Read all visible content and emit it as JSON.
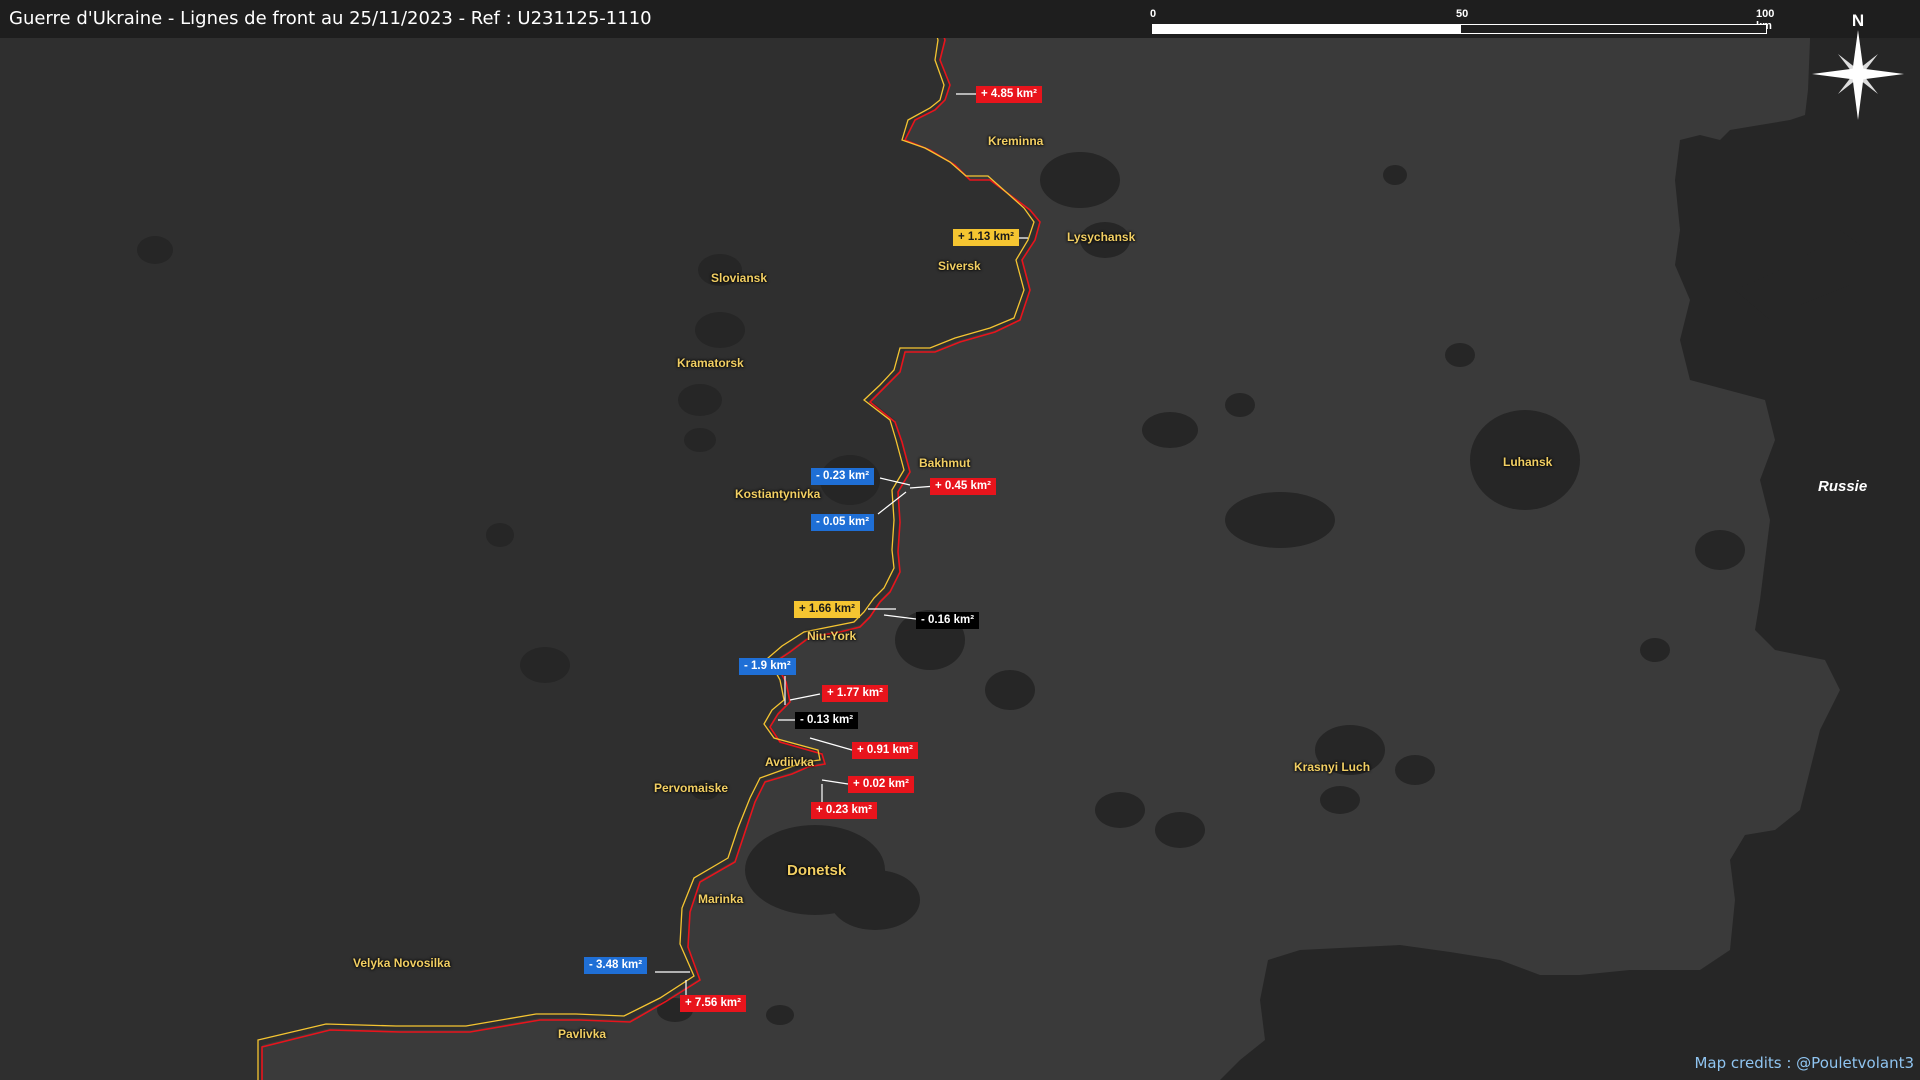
{
  "title": "Guerre d'Ukraine - Lignes de front au 25/11/2023 - Ref : U231125-1110",
  "scale_bar": {
    "labels": [
      "0",
      "50",
      "100 km"
    ]
  },
  "compass": {
    "label": "N"
  },
  "colors": {
    "ukraine_land": "#2f2f2f",
    "occupied_land": "#3a3a3a",
    "russia_land": "#262626",
    "urban_area": "#262626",
    "front_line_recent": "#f5c531",
    "front_line_previous": "#e8141c",
    "gain_red": "#e8141c",
    "loss_blue": "#1f6fd6",
    "gain_yellow": "#f5c531",
    "loss_black": "#000000"
  },
  "cities": [
    {
      "id": "kreminna",
      "name": "Kreminna"
    },
    {
      "id": "lysychansk",
      "name": "Lysychansk"
    },
    {
      "id": "siversk",
      "name": "Siversk"
    },
    {
      "id": "sloviansk",
      "name": "Sloviansk"
    },
    {
      "id": "kramatorsk",
      "name": "Kramatorsk"
    },
    {
      "id": "bakhmut",
      "name": "Bakhmut"
    },
    {
      "id": "kostiantynivka",
      "name": "Kostiantynivka"
    },
    {
      "id": "luhansk",
      "name": "Luhansk"
    },
    {
      "id": "niu-york",
      "name": "Niu-York"
    },
    {
      "id": "avdiivka",
      "name": "Avdiivka"
    },
    {
      "id": "pervomaiske",
      "name": "Pervomaiske"
    },
    {
      "id": "donetsk",
      "name": "Donetsk"
    },
    {
      "id": "marinka",
      "name": "Marinka"
    },
    {
      "id": "krasnyi-luch",
      "name": "Krasnyi Luch"
    },
    {
      "id": "velyka-novosilka",
      "name": "Velyka Novosilka"
    },
    {
      "id": "pavlivka",
      "name": "Pavlivka"
    }
  ],
  "country_label": "Russie",
  "area_changes": [
    {
      "id": "c1",
      "text": "+ 4.85 km²",
      "kind": "red"
    },
    {
      "id": "c2",
      "text": "+ 1.13 km²",
      "kind": "yellow"
    },
    {
      "id": "c3",
      "text": "- 0.23 km²",
      "kind": "blue"
    },
    {
      "id": "c4",
      "text": "+ 0.45 km²",
      "kind": "red"
    },
    {
      "id": "c5",
      "text": "- 0.05 km²",
      "kind": "blue"
    },
    {
      "id": "c6",
      "text": "+ 1.66 km²",
      "kind": "yellow"
    },
    {
      "id": "c7",
      "text": "- 0.16 km²",
      "kind": "black"
    },
    {
      "id": "c8",
      "text": "- 1.9 km²",
      "kind": "blue"
    },
    {
      "id": "c9",
      "text": "+ 1.77 km²",
      "kind": "red"
    },
    {
      "id": "c10",
      "text": "- 0.13 km²",
      "kind": "black"
    },
    {
      "id": "c11",
      "text": "+ 0.91 km²",
      "kind": "red"
    },
    {
      "id": "c12",
      "text": "+ 0.02 km²",
      "kind": "red"
    },
    {
      "id": "c13",
      "text": "+ 0.23 km²",
      "kind": "red"
    },
    {
      "id": "c14",
      "text": "- 3.48 km²",
      "kind": "blue"
    },
    {
      "id": "c15",
      "text": "+ 7.56 km²",
      "kind": "red"
    }
  ],
  "credits": "Map credits : @Pouletvolant3"
}
